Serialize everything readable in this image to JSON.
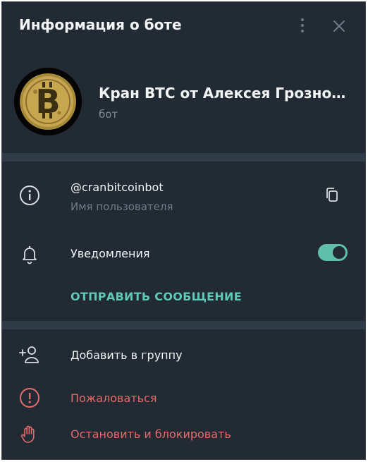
{
  "header": {
    "title": "Информация о боте",
    "menu_icon": "more-vertical-icon",
    "close_icon": "close-icon"
  },
  "profile": {
    "avatar_icon": "bitcoin-coin-avatar",
    "name": "Кран BTC от Алексея Грозного ...",
    "subtitle": "бот"
  },
  "info": {
    "username": "@cranbitcoinbot",
    "username_caption": "Имя пользователя",
    "notifications_label": "Уведомления",
    "notifications_on": true,
    "send_message": "ОТПРАВИТЬ СООБЩЕНИЕ"
  },
  "actions": {
    "add_to_group": "Добавить в группу",
    "report": "Пожаловаться",
    "stop_and_block": "Остановить и блокировать"
  },
  "colors": {
    "background": "#222b34",
    "accent": "#5fc8b6",
    "danger": "#e46a6a"
  }
}
